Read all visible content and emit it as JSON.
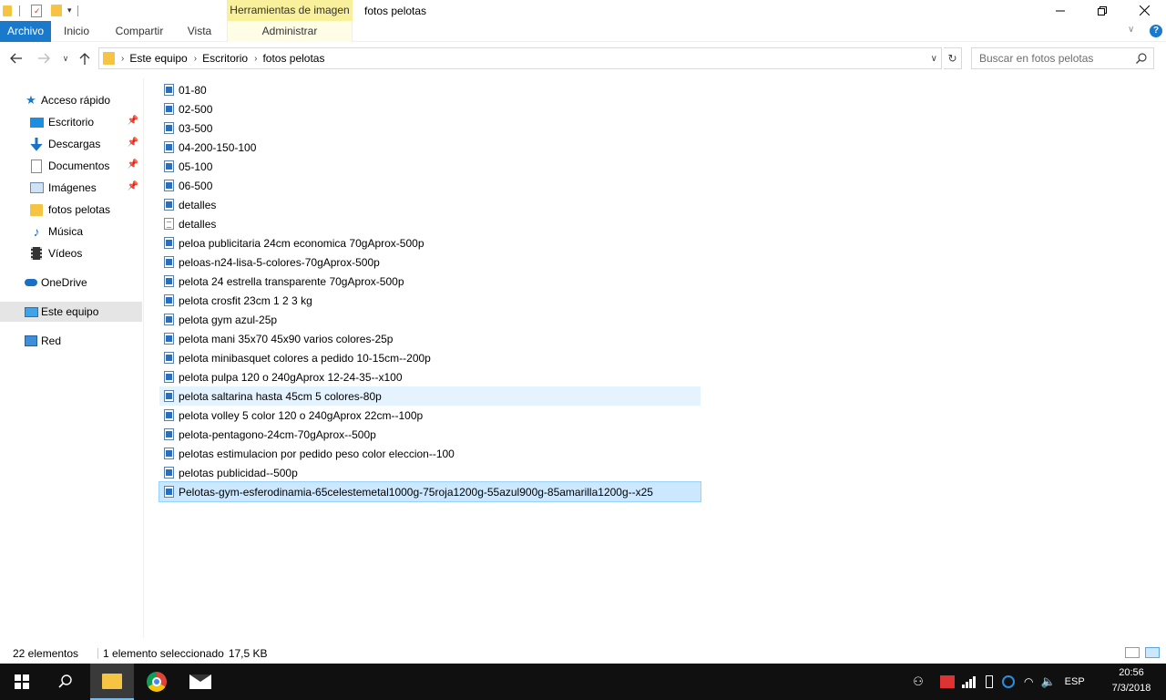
{
  "window": {
    "context_tab_group": "Herramientas de imagen",
    "title": "fotos pelotas"
  },
  "ribbon": {
    "tabs": [
      "Archivo",
      "Inicio",
      "Compartir",
      "Vista"
    ],
    "context_tab": "Administrar"
  },
  "address": {
    "breadcrumbs": [
      "Este equipo",
      "Escritorio",
      "fotos pelotas"
    ],
    "search_placeholder": "Buscar en fotos pelotas"
  },
  "sidebar": {
    "quick_access": "Acceso rápido",
    "quick_items": [
      {
        "label": "Escritorio",
        "icon": "desktop-icon",
        "pinned": true
      },
      {
        "label": "Descargas",
        "icon": "download-icon",
        "pinned": true
      },
      {
        "label": "Documentos",
        "icon": "documents-icon",
        "pinned": true
      },
      {
        "label": "Imágenes",
        "icon": "pictures-icon",
        "pinned": true
      },
      {
        "label": "fotos pelotas",
        "icon": "folder-icon",
        "pinned": false
      },
      {
        "label": "Música",
        "icon": "music-icon",
        "pinned": false
      },
      {
        "label": "Vídeos",
        "icon": "video-icon",
        "pinned": false
      }
    ],
    "onedrive": "OneDrive",
    "this_pc": "Este equipo",
    "network": "Red"
  },
  "files": [
    {
      "name": "01-80",
      "type": "image"
    },
    {
      "name": "02-500",
      "type": "image"
    },
    {
      "name": "03-500",
      "type": "image"
    },
    {
      "name": "04-200-150-100",
      "type": "image"
    },
    {
      "name": "05-100",
      "type": "image"
    },
    {
      "name": "06-500",
      "type": "image"
    },
    {
      "name": "detalles",
      "type": "image"
    },
    {
      "name": "detalles",
      "type": "text"
    },
    {
      "name": "peloa publicitaria 24cm economica 70gAprox-500p",
      "type": "image"
    },
    {
      "name": "peloas-n24-lisa-5-colores-70gAprox-500p",
      "type": "image"
    },
    {
      "name": "pelota 24 estrella transparente 70gAprox-500p",
      "type": "image"
    },
    {
      "name": "pelota crosfit 23cm 1 2 3 kg",
      "type": "image"
    },
    {
      "name": "pelota gym azul-25p",
      "type": "image"
    },
    {
      "name": "pelota mani 35x70  45x90 varios colores-25p",
      "type": "image"
    },
    {
      "name": "pelota minibasquet colores a pedido 10-15cm--200p",
      "type": "image"
    },
    {
      "name": "pelota pulpa 120 o 240gAprox 12-24-35--x100",
      "type": "image"
    },
    {
      "name": "pelota saltarina hasta 45cm 5 colores-80p",
      "type": "image",
      "state": "hover"
    },
    {
      "name": "pelota volley 5 color 120 o 240gAprox 22cm--100p",
      "type": "image"
    },
    {
      "name": "pelota-pentagono-24cm-70gAprox--500p",
      "type": "image"
    },
    {
      "name": "pelotas estimulacion por pedido peso color eleccion--100",
      "type": "image"
    },
    {
      "name": "pelotas publicidad--500p",
      "type": "image"
    },
    {
      "name": "Pelotas-gym-esferodinamia-65celestemetal1000g-75roja1200g-55azul900g-85amarilla1200g--x25",
      "type": "image",
      "state": "selected"
    }
  ],
  "status": {
    "count": "22 elementos",
    "selection": "1 elemento seleccionado",
    "size": "17,5 KB"
  },
  "taskbar": {
    "language": "ESP",
    "time": "20:56",
    "date": "7/3/2018"
  },
  "colors": {
    "accent": "#1979ca",
    "context_tab": "#f8f09a",
    "selection": "#cce8ff",
    "hover": "#e5f3ff"
  }
}
